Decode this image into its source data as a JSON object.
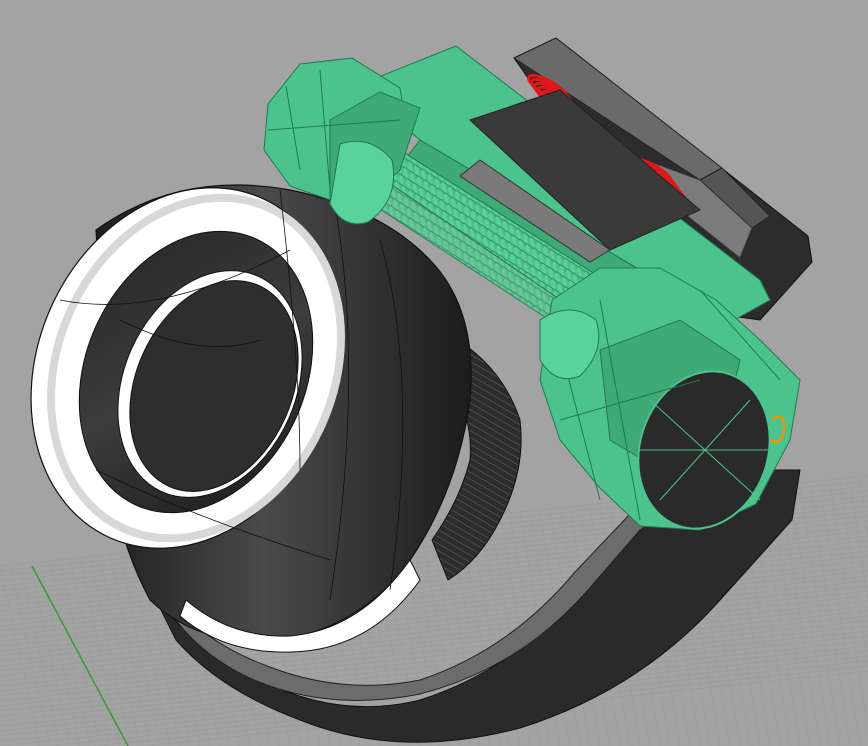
{
  "viewport": {
    "view": "perspective",
    "background_color": "#a3a3a3",
    "grid_color": "#9a9a9a",
    "axis_color": "#2f9a2f"
  },
  "model": {
    "selected_color": "#4cc38d",
    "selected_edge_color": "#1f7a52",
    "dark_color": "#2b2b2b",
    "gray_color": "#5e5e5e",
    "white_color": "#ffffff",
    "spring_color": "#e01818",
    "marker_color": "#ff8c00"
  }
}
